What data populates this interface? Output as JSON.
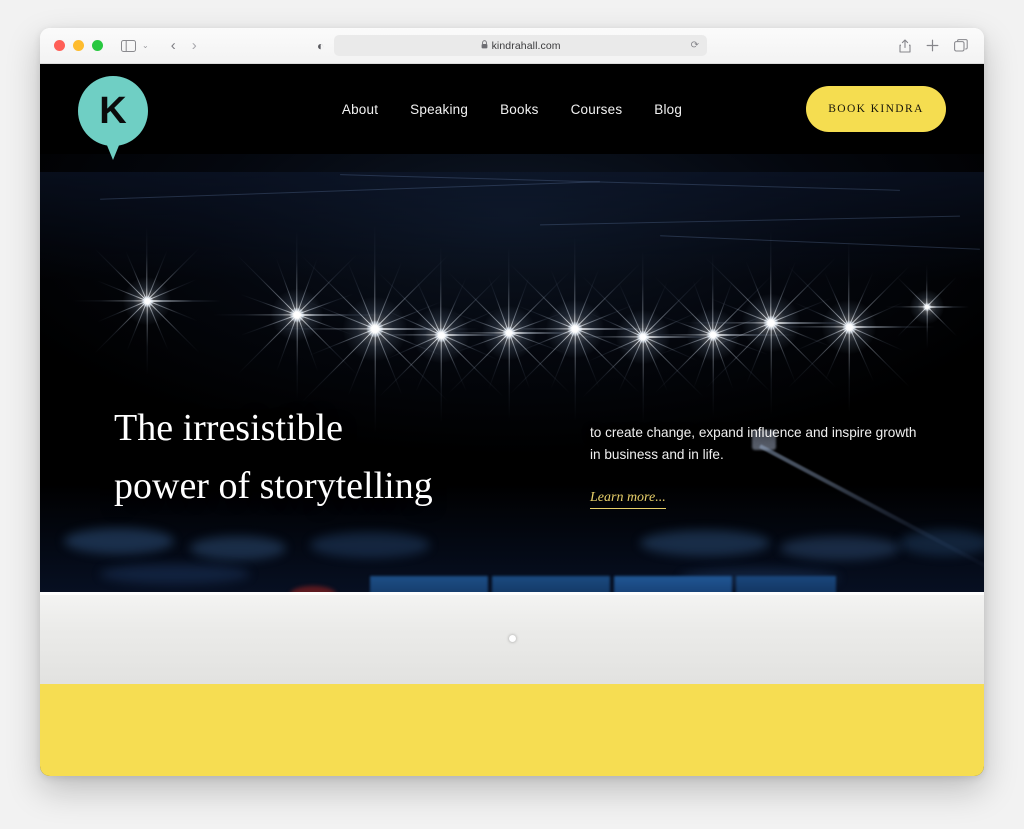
{
  "browser": {
    "traffic_lights": [
      "close",
      "minimize",
      "maximize"
    ],
    "sidebar_icon": "sidebar-icon",
    "sidebar_chevron": "⌄",
    "back_arrow": "‹",
    "forward_arrow": "›",
    "shield_icon": "◐",
    "lock_icon": "🔒",
    "url": "kindrahall.com",
    "reload_icon": "⟳",
    "share_icon": "share-icon",
    "new_tab_icon": "+",
    "tabs_icon": "tabs-icon"
  },
  "site": {
    "logo": {
      "letter": "K",
      "color": "#6fcfc4"
    },
    "nav": [
      {
        "label": "About"
      },
      {
        "label": "Speaking"
      },
      {
        "label": "Books"
      },
      {
        "label": "Courses"
      },
      {
        "label": "Blog"
      }
    ],
    "cta": {
      "label": "BOOK KINDRA",
      "color": "#f5dd50"
    }
  },
  "hero": {
    "headline_line1": "The irresistible",
    "headline_line2": "power of storytelling",
    "subtext": "to create change, expand influence and inspire growth in business and in life.",
    "learn_more": "Learn more...",
    "accent_color": "#e8d06a",
    "carousel_dots": 1
  },
  "footer_band": {
    "color": "#f6dd52"
  }
}
